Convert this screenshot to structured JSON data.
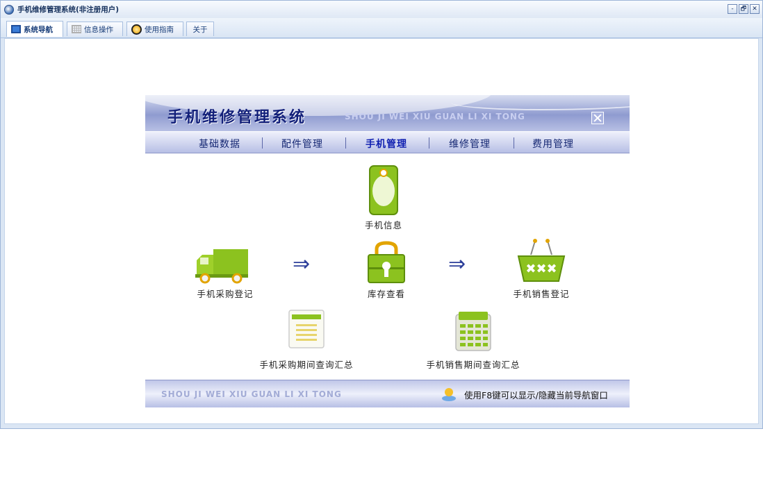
{
  "window": {
    "title": "手机维修管理系统(非注册用户)",
    "controls": {
      "minimize": "-",
      "restore": "🗗",
      "close": "✕"
    }
  },
  "tabs": [
    {
      "label": "系统导航",
      "icon": "nav-icon",
      "active": true
    },
    {
      "label": "信息操作",
      "icon": "grid-icon",
      "active": false
    },
    {
      "label": "使用指南",
      "icon": "guide-icon",
      "active": false
    },
    {
      "label": "关于",
      "icon": "",
      "active": false
    }
  ],
  "panel": {
    "title": "手机维修管理系统",
    "subtitle": "SHOU JI WEI XIU GUAN LI XI TONG",
    "menu": [
      {
        "label": "基础数据",
        "active": false
      },
      {
        "label": "配件管理",
        "active": false
      },
      {
        "label": "手机管理",
        "active": true
      },
      {
        "label": "维修管理",
        "active": false
      },
      {
        "label": "费用管理",
        "active": false
      }
    ],
    "nodes": {
      "phone_info": "手机信息",
      "purchase": "手机采购登记",
      "stock": "库存查看",
      "sales": "手机销售登记",
      "purchase_summary": "手机采购期间查询汇总",
      "sales_summary": "手机销售期间查询汇总"
    },
    "arrow_glyph": "⇒",
    "footer": {
      "subtitle": "SHOU JI WEI XIU GUAN LI XI TONG",
      "tip": "使用F8键可以显示/隐藏当前导航窗口"
    }
  },
  "colors": {
    "accent": "#13207a",
    "menu_active": "#0f1fb0",
    "icon_green": "#8cc21f",
    "arrow": "#2d3f9a"
  }
}
